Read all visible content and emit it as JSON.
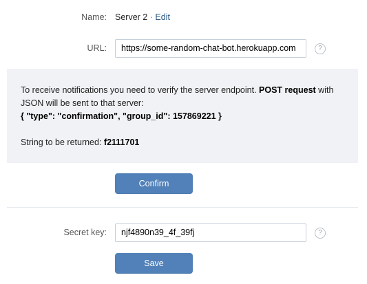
{
  "server": {
    "name_label": "Name:",
    "name_value": "Server 2",
    "separator": "·",
    "edit_label": "Edit",
    "url_label": "URL:",
    "url_value": "https://some-random-chat-bot.herokuapp.com"
  },
  "notice": {
    "line1_prefix": "To receive notifications you need to verify the server endpoint. ",
    "line1_bold": "POST request",
    "line1_suffix": " with",
    "line2": "JSON will be sent to that server:",
    "json_payload": "{ \"type\": \"confirmation\", \"group_id\": 157869221 }",
    "return_label": "String to be returned: ",
    "return_value": "f2111701"
  },
  "confirm_button": "Confirm",
  "secret": {
    "label": "Secret key:",
    "value": "njf4890n39_4f_39fj"
  },
  "save_button": "Save",
  "help_glyph": "?",
  "colors": {
    "button": "#5181b8",
    "link": "#2a5885",
    "panel": "#f0f2f5",
    "border": "#c5d0db"
  }
}
